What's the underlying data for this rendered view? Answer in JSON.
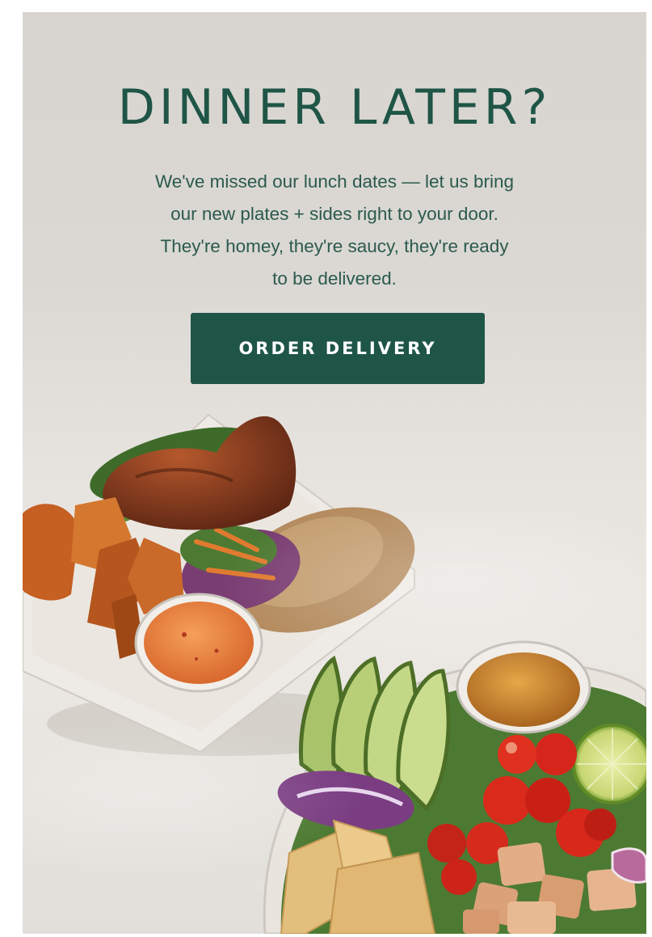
{
  "promo": {
    "headline": "DINNER LATER?",
    "body_lines": [
      "We've missed our lunch dates — let us bring",
      "our new plates + sides right to your door.",
      "They're homey, they're saucy, they're ready",
      "to be delivered."
    ],
    "cta_label": "ORDER DELIVERY"
  },
  "colors": {
    "brand_green": "#1e5547",
    "headline_green": "#1f5546",
    "background": "#dbd8d3"
  },
  "images": {
    "plate": "chicken-plate-photo",
    "bowl": "salad-bowl-photo"
  }
}
